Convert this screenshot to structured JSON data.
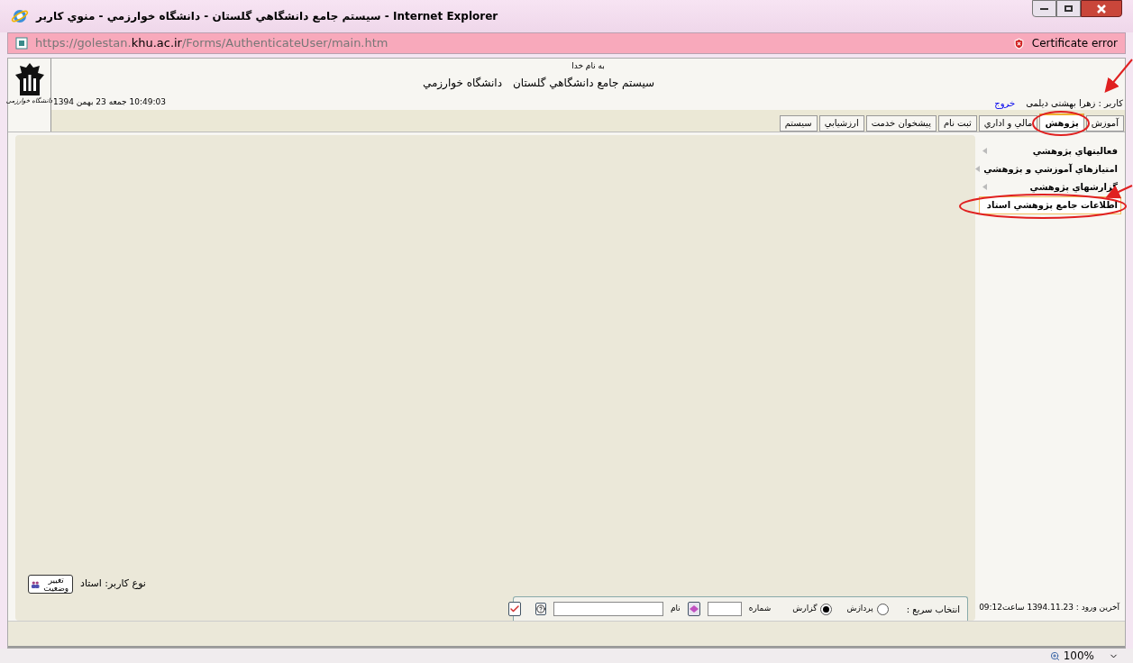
{
  "window": {
    "title": "سيستم جامع دانشگاهي گلستان - دانشگاه خوارزمي - منوي كاربر - Internet Explorer"
  },
  "address_bar": {
    "url": "https://golestan.**khu.ac.ir**/Forms/AuthenticateUser/main.htm",
    "certificate_error": "Certificate error"
  },
  "header": {
    "logo_text": "دانشگاه خوارزمی",
    "blessing": "به نام خدا",
    "system_name": "سيستم جامع دانشگاهي گلستان",
    "university": "دانشگاه خوارزمي",
    "datetime": "10:49:03 جمعه 23 بهمن 1394",
    "user": "کاربر : زهرا بهشتی دیلمی",
    "logout": "خروج"
  },
  "tabs": [
    {
      "label": "آموزش",
      "selected": false
    },
    {
      "label": "پژوهش",
      "selected": true
    },
    {
      "label": "مالي و اداري",
      "selected": false
    },
    {
      "label": "ثبت نام",
      "selected": false
    },
    {
      "label": "پيشخوان خدمت",
      "selected": false
    },
    {
      "label": "ارزشيابي",
      "selected": false
    },
    {
      "label": "سيستم",
      "selected": false
    }
  ],
  "sidebar": {
    "items": [
      {
        "label": "فعاليتهاي پژوهشي",
        "has_submenu": true,
        "selected": false
      },
      {
        "label": "امتيازهاي آموزشي و پژوهشي",
        "has_submenu": true,
        "selected": false
      },
      {
        "label": "گزارشهاي پژوهشي",
        "has_submenu": true,
        "selected": false
      },
      {
        "label": "اطلاعات جامع پژوهشي استاد",
        "has_submenu": false,
        "selected": true
      }
    ],
    "last_login": "آخرین ورود : 1394.11.23 ساعت09:12"
  },
  "user_type": {
    "label": "نوع کاربر: استاد",
    "change_button": "تغيير وضعيت"
  },
  "quick_select": {
    "label": "انتخاب سريع :",
    "options": [
      {
        "label": "پردازش",
        "selected": false
      },
      {
        "label": "گزارش",
        "selected": true
      }
    ],
    "number_label": "شماره",
    "name_label": "نام"
  },
  "status_bar": {
    "zoom": "100%"
  }
}
